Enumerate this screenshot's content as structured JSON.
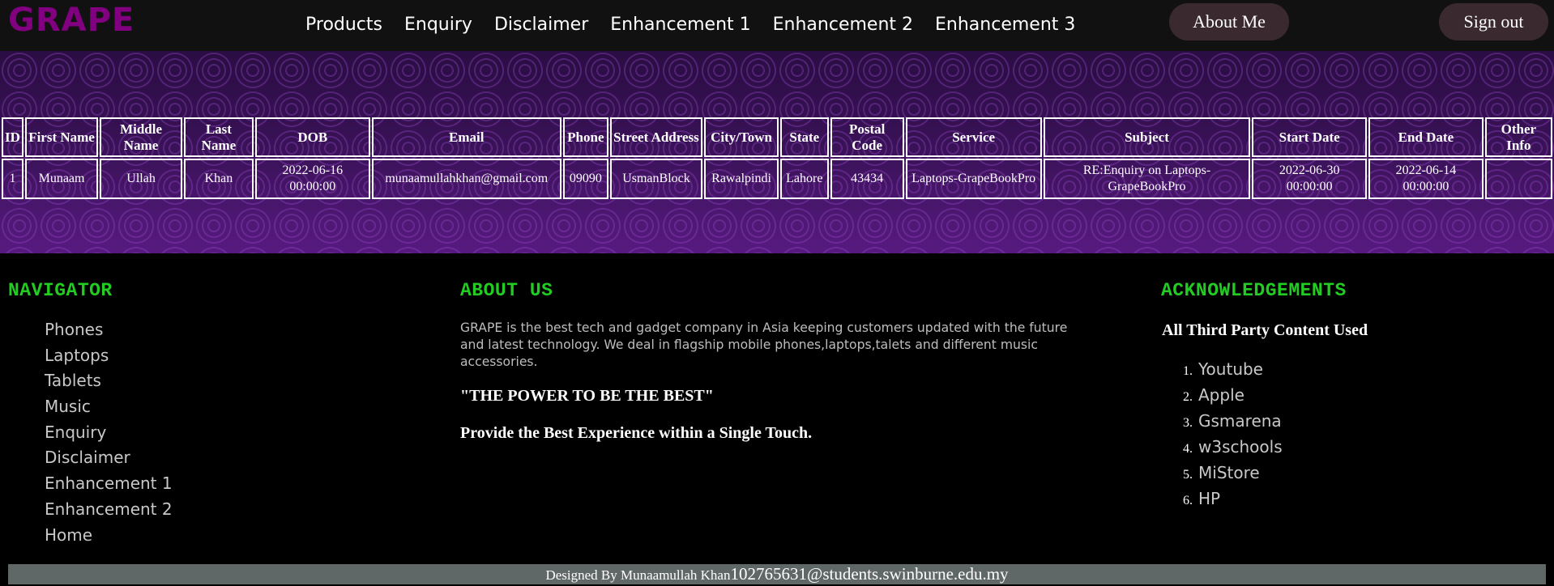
{
  "header": {
    "logo": "GRAPE",
    "nav": [
      "Products",
      "Enquiry",
      "Disclaimer",
      "Enhancement 1",
      "Enhancement 2",
      "Enhancement 3"
    ],
    "about_label": "About Me",
    "signout_label": "Sign out"
  },
  "table": {
    "headers": [
      "ID",
      "First Name",
      "Middle Name",
      "Last Name",
      "DOB",
      "Email",
      "Phone",
      "Street Address",
      "City/Town",
      "State",
      "Postal Code",
      "Service",
      "Subject",
      "Start Date",
      "End Date",
      "Other Info"
    ],
    "rows": [
      [
        "1",
        "Munaam",
        "Ullah",
        "Khan",
        "2022-06-16 00:00:00",
        "munaamullahkhan@gmail.com",
        "09090",
        "UsmanBlock",
        "Rawalpindi",
        "Lahore",
        "43434",
        "Laptops-GrapeBookPro",
        "RE:Enquiry on Laptops-GrapeBookPro",
        "2022-06-30 00:00:00",
        "2022-06-14 00:00:00",
        ""
      ]
    ]
  },
  "footer": {
    "navigator_heading": "NAVIGATOR",
    "navigator_items": [
      "Phones",
      "Laptops",
      "Tablets",
      "Music",
      "Enquiry",
      "Disclaimer",
      "Enhancement 1",
      "Enhancement 2",
      "Home"
    ],
    "about_heading": "ABOUT US",
    "about_text": "GRAPE is the best tech and gadget company in Asia keeping customers updated with the future and latest technology. We deal in flagship mobile phones,laptops,talets and different music accessories.",
    "quote": "\"THE POWER TO BE THE BEST\"",
    "tagline": "Provide the Best Experience within a Single Touch.",
    "ack_heading": "ACKNOWLEDGEMENTS",
    "ack_subheading": "All Third Party Content Used",
    "ack_items": [
      "Youtube",
      "Apple",
      "Gsmarena",
      "w3schools",
      "MiStore",
      "HP"
    ],
    "designed_by": "Designed By Munaamullah Khan",
    "email": "102765631@students.swinburne.edu.my"
  },
  "colors": {
    "logo": "#800080",
    "heading_green": "#22cc22",
    "topbar": "#111111",
    "pill": "#3a2a30",
    "footbar": "#5f6866"
  }
}
